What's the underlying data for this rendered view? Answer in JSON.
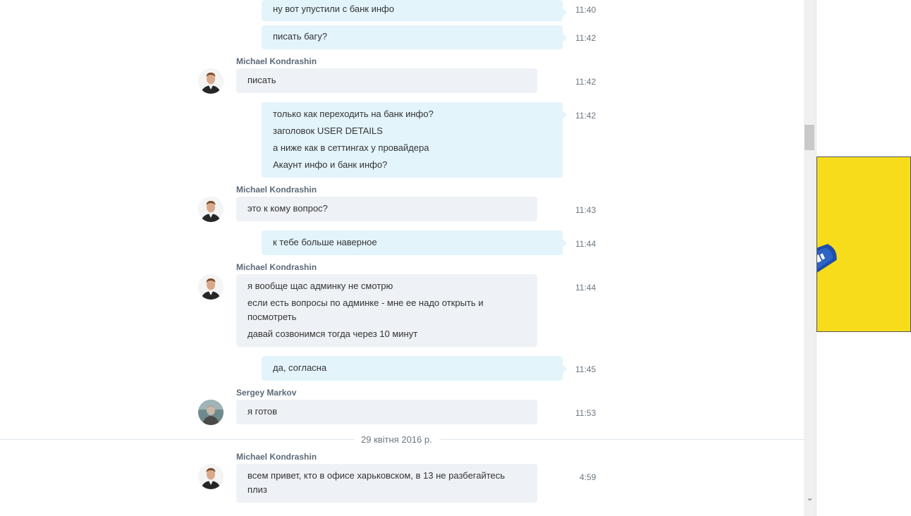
{
  "messages": [
    {
      "type": "out",
      "lines": [
        "ну вот упустили с банк инфо"
      ],
      "time": "11:40"
    },
    {
      "type": "out",
      "lines": [
        "писать багу?"
      ],
      "time": "11:42"
    },
    {
      "type": "in",
      "sender": "Michael Kondrashin",
      "lines": [
        "писать"
      ],
      "time": "11:42"
    },
    {
      "type": "out",
      "lines": [
        "только как переходить на банк инфо?",
        "заголовок USER DETAILS",
        "а ниже как в сеттингах у провайдера",
        "Акаунт инфо и банк инфо?"
      ],
      "time": "11:42"
    },
    {
      "type": "in",
      "sender": "Michael Kondrashin",
      "lines": [
        "это к кому вопрос?"
      ],
      "time": "11:43"
    },
    {
      "type": "out",
      "lines": [
        "к тебе больше наверное"
      ],
      "time": "11:44"
    },
    {
      "type": "in",
      "sender": "Michael Kondrashin",
      "lines": [
        "я вообще щас админку не смотрю",
        "если есть вопросы по админке - мне ее надо открыть и",
        "посмотреть",
        "давай созвонимся тогда через 10 минут"
      ],
      "time": "11:44"
    },
    {
      "type": "out",
      "lines": [
        "да, согласна"
      ],
      "time": "11:45"
    },
    {
      "type": "in",
      "sender": "Sergey Markov",
      "lines": [
        "я готов"
      ],
      "time": "11:53"
    },
    {
      "type": "in",
      "sender": "Michael Kondrashin",
      "lines": [
        "всем привет, кто в офисе харьковском, в 13 не разбегайтесь",
        "плиз"
      ],
      "time": "4:59"
    }
  ],
  "date_separator": "29 квітня 2016 р.",
  "colors": {
    "incoming": "#eef1f5",
    "outgoing": "#e3f4fb",
    "ad": "#f7dc1c"
  },
  "icons": {
    "scroll_down": "chevron-down-icon"
  }
}
